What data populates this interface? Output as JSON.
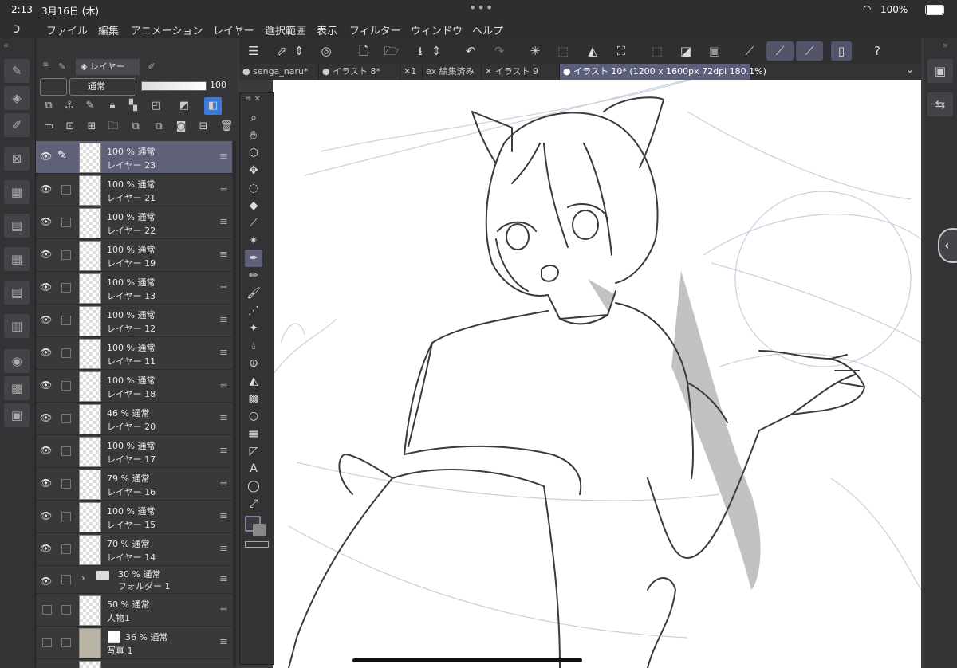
{
  "status": {
    "time": "2:13",
    "date": "3月16日 (木)",
    "battery": "100%"
  },
  "menu": [
    "ファイル",
    "編集",
    "アニメーション",
    "レイヤー",
    "選択範囲",
    "表示",
    "フィルター",
    "ウィンドウ",
    "ヘルプ"
  ],
  "layer_panel": {
    "tab_label": "レイヤー",
    "blend_mode": "通常",
    "opacity_value": "100",
    "layers": [
      {
        "opacity": "100 %",
        "mode": "通常",
        "name": "レイヤー 23",
        "selected": true
      },
      {
        "opacity": "100 %",
        "mode": "通常",
        "name": "レイヤー 21"
      },
      {
        "opacity": "100 %",
        "mode": "通常",
        "name": "レイヤー 22"
      },
      {
        "opacity": "100 %",
        "mode": "通常",
        "name": "レイヤー 19"
      },
      {
        "opacity": "100 %",
        "mode": "通常",
        "name": "レイヤー 13"
      },
      {
        "opacity": "100 %",
        "mode": "通常",
        "name": "レイヤー 12"
      },
      {
        "opacity": "100 %",
        "mode": "通常",
        "name": "レイヤー 11"
      },
      {
        "opacity": "100 %",
        "mode": "通常",
        "name": "レイヤー 18"
      },
      {
        "opacity": "46 %",
        "mode": "通常",
        "name": "レイヤー 20"
      },
      {
        "opacity": "100 %",
        "mode": "通常",
        "name": "レイヤー 17"
      },
      {
        "opacity": "79 %",
        "mode": "通常",
        "name": "レイヤー 16"
      },
      {
        "opacity": "100 %",
        "mode": "通常",
        "name": "レイヤー 15"
      },
      {
        "opacity": "70 %",
        "mode": "通常",
        "name": "レイヤー 14"
      },
      {
        "opacity": "30 %",
        "mode": "通常",
        "name": "フォルダー 1",
        "folder": true
      },
      {
        "opacity": "50 %",
        "mode": "通常",
        "name": "人物1",
        "hidden": true
      },
      {
        "opacity": "36 %",
        "mode": "通常",
        "name": "写真 1",
        "hidden": true
      }
    ]
  },
  "doc_tabs": [
    {
      "label": "senga_naru*"
    },
    {
      "label": "イラスト 8*"
    },
    {
      "label": "1"
    },
    {
      "label": "ex 編集済み"
    },
    {
      "label": "イラスト 9"
    },
    {
      "label": "イラスト 10* (1200 x 1600px 72dpi 180.1%)",
      "active": true
    }
  ],
  "colors": {
    "accent": "#5e6178",
    "panel": "#363639",
    "canvas": "#ffffff"
  }
}
